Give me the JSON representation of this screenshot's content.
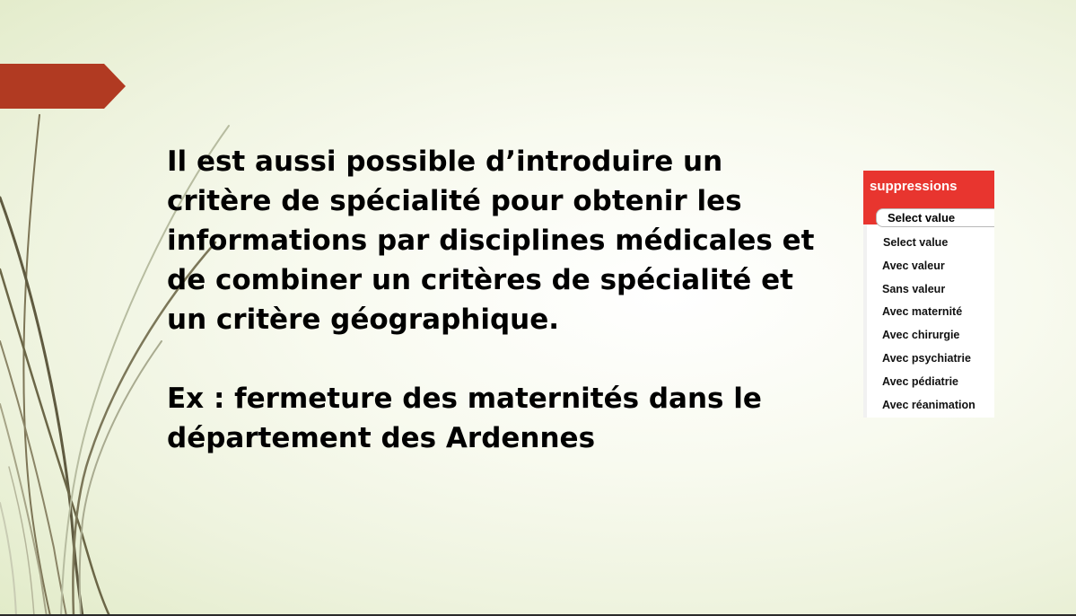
{
  "slide": {
    "paragraphs": [
      "Il est aussi possible d’introduire un critère de spécialité pour obtenir les informations par disciplines médicales et de combiner un critères de spécialité et un critère géographique.",
      "Ex : fermeture des maternités dans le département des Ardennes"
    ]
  },
  "dropdown": {
    "header": "suppressions",
    "selected": "Select value",
    "options": [
      "Select value",
      "Avec valeur",
      "Sans valeur",
      "Avec maternité",
      "Avec chirurgie",
      "Avec psychiatrie",
      "Avec pédiatrie",
      "Avec réanimation"
    ]
  },
  "colors": {
    "accent_arrow": "#b13a22",
    "header_red": "#e8352f",
    "vine": "#6b6647"
  }
}
